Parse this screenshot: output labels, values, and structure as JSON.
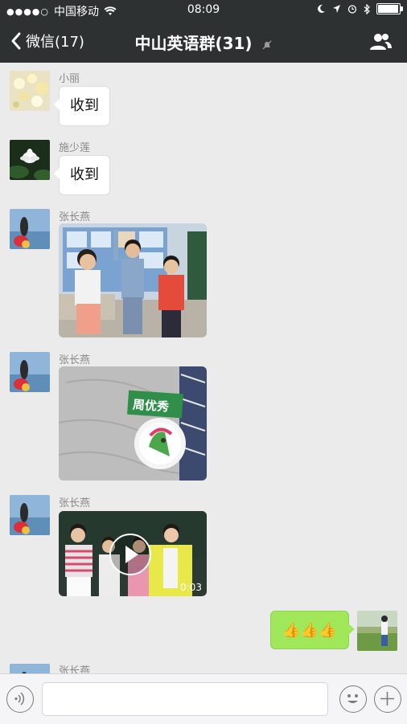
{
  "status_bar": {
    "signal_dots": "●●●●○",
    "carrier": "中国移动",
    "time": "08:09",
    "battery_level_percent": 95
  },
  "nav": {
    "back_label": "微信(17)",
    "title": "中山英语群(31)"
  },
  "messages": [
    {
      "sender": "小丽",
      "type": "text",
      "text": "收到"
    },
    {
      "sender": "施少莲",
      "type": "text",
      "text": "收到"
    },
    {
      "sender": "张长燕",
      "type": "image"
    },
    {
      "sender": "张长燕",
      "type": "image"
    },
    {
      "sender": "张长燕",
      "type": "video",
      "duration": "0:03"
    },
    {
      "sender": "me",
      "type": "emoji",
      "text": "👍👍👍"
    },
    {
      "sender": "张长燕",
      "type": "partial"
    }
  ],
  "input": {
    "placeholder": ""
  },
  "colors": {
    "nav_background": "#2e3132",
    "chat_background": "#ebebeb",
    "sent_bubble": "#a0e75a"
  },
  "icons": [
    "chevron-left-icon",
    "mute-bell-icon",
    "group-members-icon",
    "voice-icon",
    "emoji-icon",
    "plus-icon",
    "wifi-icon",
    "moon-icon",
    "location-icon",
    "alarm-icon",
    "bluetooth-icon",
    "battery-icon"
  ]
}
